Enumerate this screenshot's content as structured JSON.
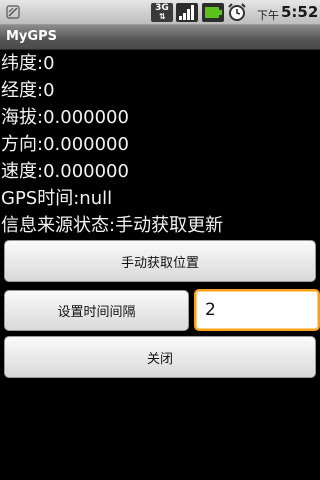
{
  "status_bar": {
    "network_type": "3G",
    "ampm": "下午",
    "time": "5:52",
    "icons": [
      "notification-icon",
      "3g-data-icon",
      "signal-icon",
      "battery-charging-icon",
      "alarm-clock-icon"
    ],
    "battery_color": "#5ec21c"
  },
  "app": {
    "title": "MyGPS"
  },
  "info": {
    "latitude": "纬度:0",
    "longitude": "经度:0",
    "altitude": "海拔:0.000000",
    "bearing": "方向:0.000000",
    "speed": "速度:0.000000",
    "gps_time": "GPS时间:null",
    "source_status": "信息来源状态:手动获取更新"
  },
  "controls": {
    "manual_fetch_label": "手动获取位置",
    "set_interval_label": "设置时间间隔",
    "interval_value": "2",
    "close_label": "关闭",
    "focus_color": "#f5a21a"
  }
}
